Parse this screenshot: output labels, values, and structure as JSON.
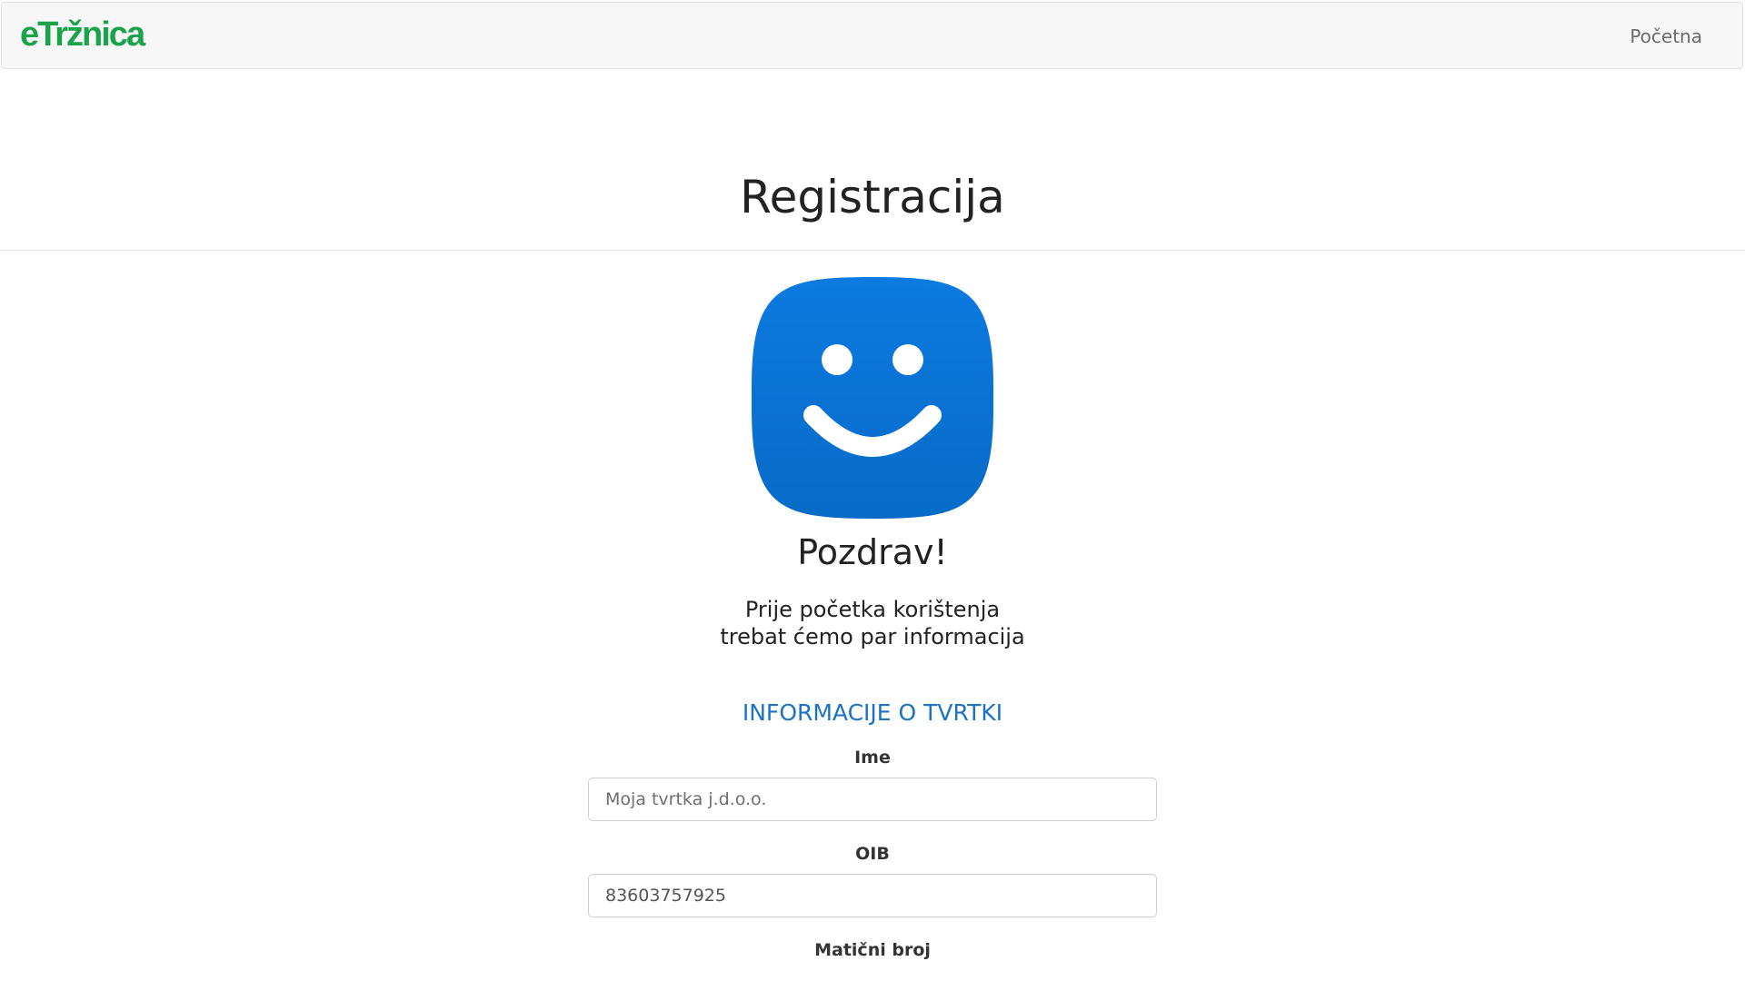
{
  "navbar": {
    "brand": "eTržnica",
    "links": [
      {
        "label": "Početna"
      }
    ]
  },
  "page": {
    "title": "Registracija"
  },
  "welcome": {
    "icon": "smiley-face-icon",
    "greeting": "Pozdrav!",
    "intro_line_1": "Prije početka korištenja",
    "intro_line_2": "trebat ćemo par informacija"
  },
  "company_section": {
    "title": "INFORMACIJE O TVRTKI",
    "fields": [
      {
        "label": "Ime",
        "value": "",
        "placeholder": "Moja tvrtka j.d.o.o."
      },
      {
        "label": "OIB",
        "value": "83603757925",
        "placeholder": ""
      },
      {
        "label": "Matični broj"
      }
    ]
  },
  "colors": {
    "brand": "#1aa34a",
    "accent": "#1b72c9",
    "icon_background": "#0a73d4"
  }
}
